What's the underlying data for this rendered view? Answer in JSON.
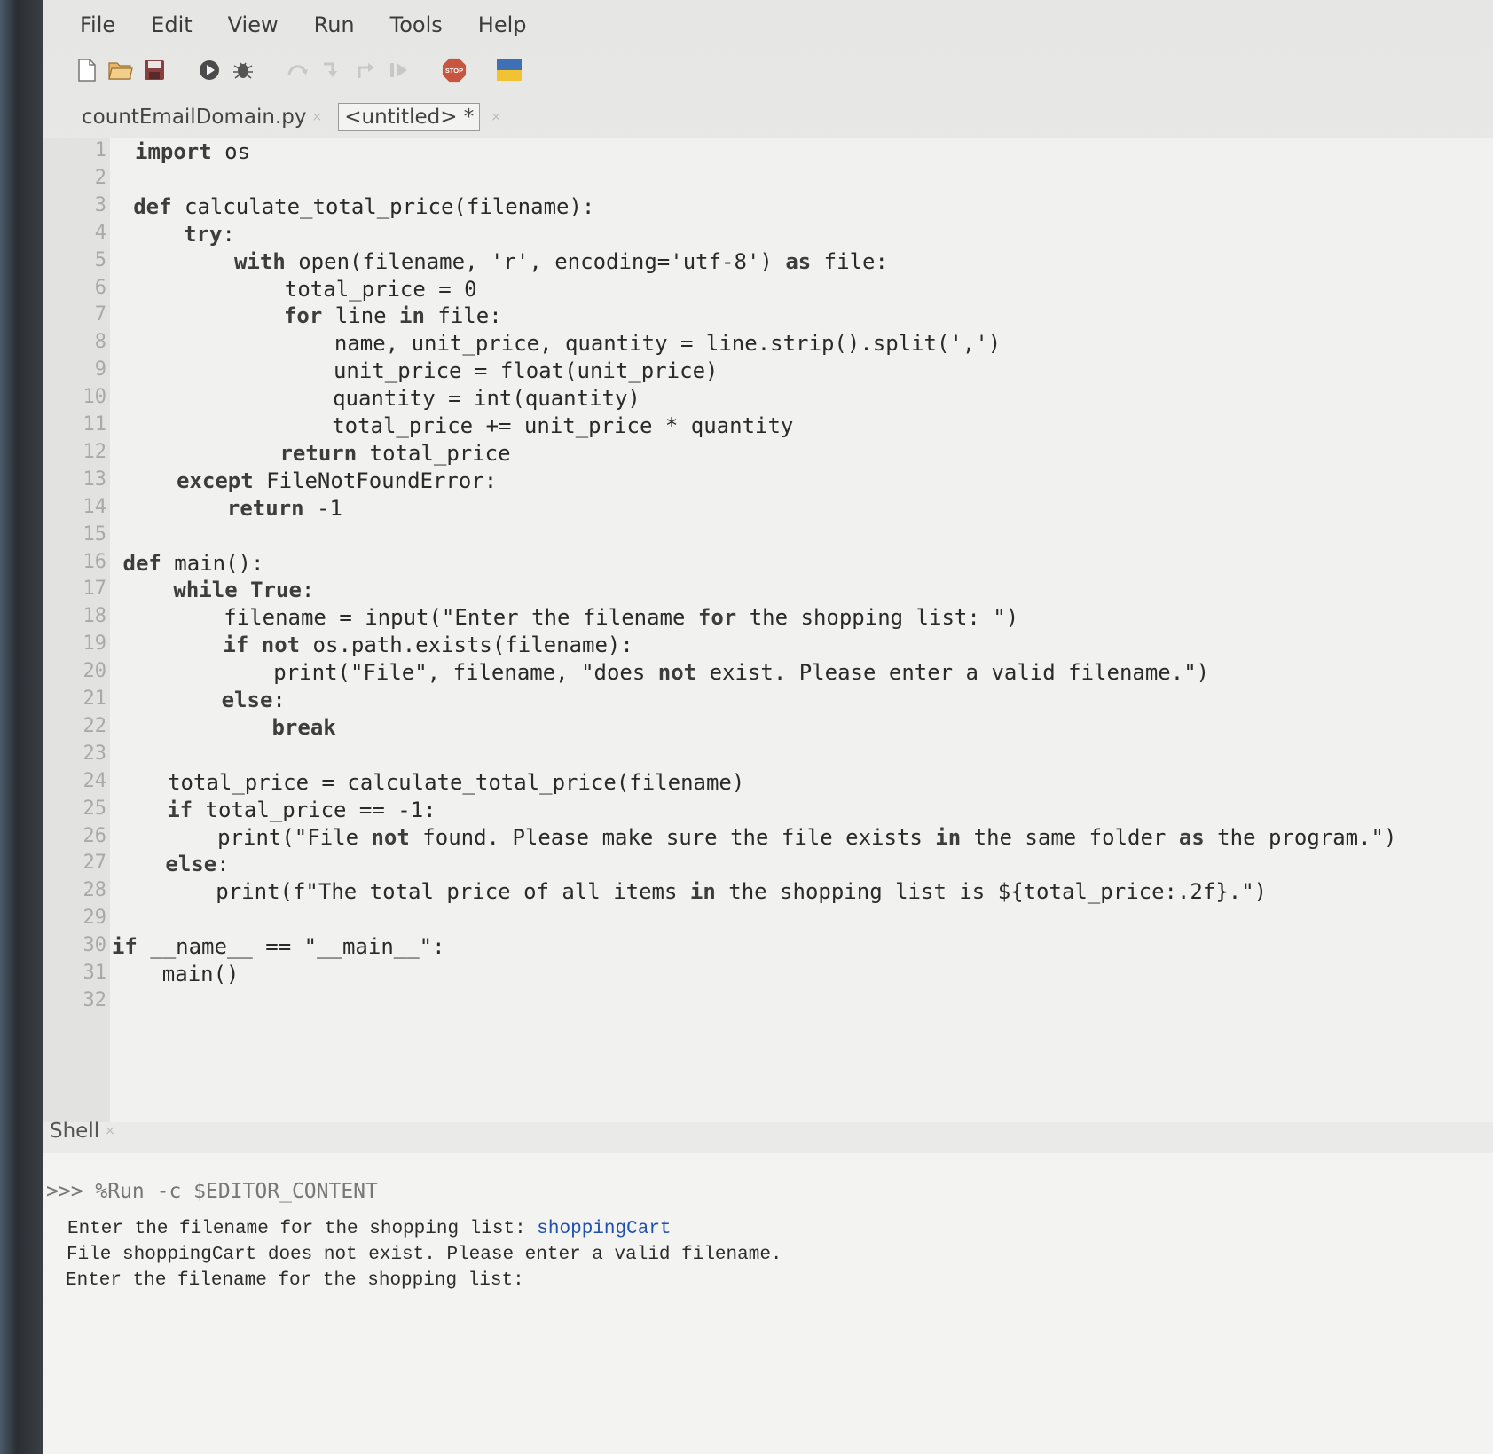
{
  "menu": [
    "File",
    "Edit",
    "View",
    "Run",
    "Tools",
    "Help"
  ],
  "toolbar": {
    "icons": [
      "new-file-icon",
      "open-file-icon",
      "save-icon",
      "run-icon",
      "debug-icon",
      "step-over-icon",
      "step-into-icon",
      "step-out-icon",
      "resume-icon",
      "stop-icon",
      "support-ukraine-icon"
    ],
    "stop_label": "STOP"
  },
  "tabs": [
    {
      "label": "countEmailDomain.py",
      "active": false
    },
    {
      "label": "<untitled> *",
      "active": true
    }
  ],
  "editor": {
    "lines": [
      "import os",
      "",
      "def calculate_total_price(filename):",
      "    try:",
      "        with open(filename, 'r', encoding='utf-8') as file:",
      "            total_price = 0",
      "            for line in file:",
      "                name, unit_price, quantity = line.strip().split(',')",
      "                unit_price = float(unit_price)",
      "                quantity = int(quantity)",
      "                total_price += unit_price * quantity",
      "            return total_price",
      "    except FileNotFoundError:",
      "        return -1",
      "",
      "def main():",
      "    while True:",
      "        filename = input(\"Enter the filename for the shopping list: \")",
      "        if not os.path.exists(filename):",
      "            print(\"File\", filename, \"does not exist. Please enter a valid filename.\")",
      "        else:",
      "            break",
      "",
      "    total_price = calculate_total_price(filename)",
      "    if total_price == -1:",
      "        print(\"File not found. Please make sure the file exists in the same folder as the program.\")",
      "    else:",
      "        print(f\"The total price of all items in the shopping list is ${total_price:.2f}.\")",
      "",
      "if __name__ == \"__main__\":",
      "    main()",
      ""
    ]
  },
  "shell": {
    "tab_label": "Shell",
    "prompt": ">>> %Run -c $EDITOR_CONTENT",
    "output": [
      {
        "text": "Enter the filename for the shopping list: ",
        "input": "shoppingCart"
      },
      {
        "text": "File shoppingCart does not exist. Please enter a valid filename.",
        "input": ""
      },
      {
        "text": "Enter the filename for the shopping list:",
        "input": ""
      }
    ]
  }
}
